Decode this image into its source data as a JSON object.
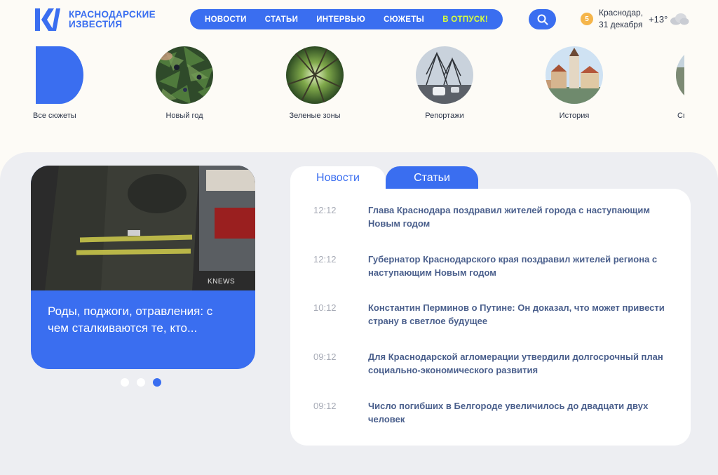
{
  "header": {
    "logo_line1": "КРАСНОДАРСКИЕ",
    "logo_line2": "ИЗВЕСТИЯ",
    "nav": [
      {
        "label": "НОВОСТИ"
      },
      {
        "label": "СТАТЬИ"
      },
      {
        "label": "ИНТЕРВЬЮ"
      },
      {
        "label": "СЮЖЕТЫ"
      },
      {
        "label": "В ОТПУСК!"
      }
    ],
    "weather": {
      "badge": "5",
      "city": "Краснодар,",
      "date": "31 декабря",
      "temp": "+13°"
    }
  },
  "stories": [
    {
      "label": "Все сюжеты"
    },
    {
      "label": "Новый год"
    },
    {
      "label": "Зеленые зоны"
    },
    {
      "label": "Репортажи"
    },
    {
      "label": "История"
    },
    {
      "label": "Спорт"
    }
  ],
  "featured": {
    "title": "Роды, поджоги, отравления: с чем сталкиваются те, кто...",
    "watermark": "KNEWS",
    "active_slide": 3,
    "slide_count": 3
  },
  "tabs": [
    {
      "label": "Новости"
    },
    {
      "label": "Статьи"
    }
  ],
  "news": [
    {
      "time": "12:12",
      "title": "Глава Краснодара поздравил жителей города с наступающим Новым годом"
    },
    {
      "time": "12:12",
      "title": "Губернатор Краснодарского края поздравил жителей региона с наступающим Новым годом"
    },
    {
      "time": "10:12",
      "title": "Константин Перминов о Путине: Он доказал, что может привести страну в светлое будущее"
    },
    {
      "time": "09:12",
      "title": "Для Краснодарской агломерации утвердили долгосрочный план социально-экономического развития"
    },
    {
      "time": "09:12",
      "title": "Число погибших в Белгороде увеличилось до двадцати двух человек"
    }
  ],
  "colors": {
    "brand": "#3a6ef0",
    "accent": "#d8ff3a",
    "panel": "#edeef2"
  }
}
